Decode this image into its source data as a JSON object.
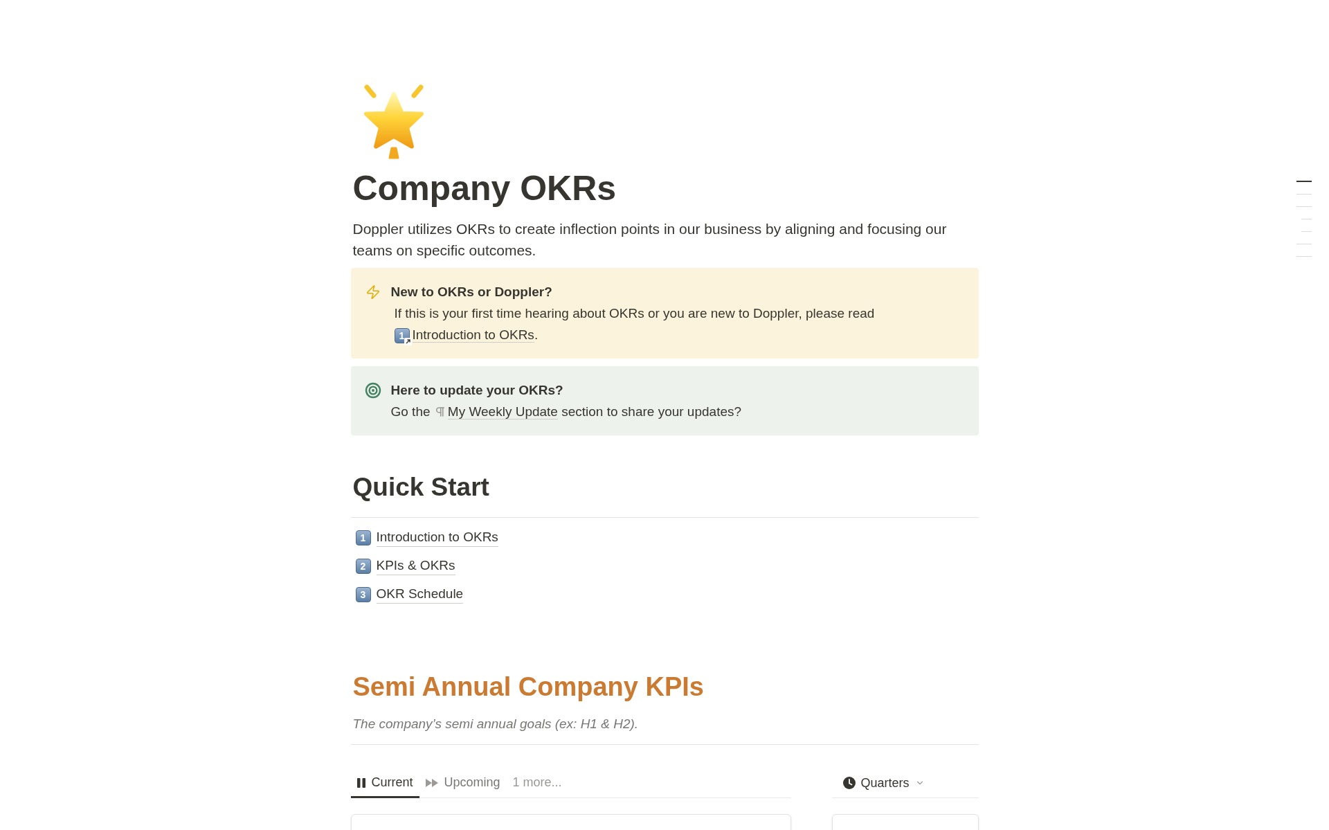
{
  "page": {
    "title": "Company OKRs",
    "description": "Doppler utilizes OKRs to create inflection points in our business by aligning and focusing our teams on specific outcomes."
  },
  "callouts": [
    {
      "kind": "lightning",
      "color": "#fbf3db",
      "title": "New to OKRs or Doppler?",
      "text": "If this is your first time hearing about OKRs or you are new to Doppler, please read",
      "link": {
        "kind": "page",
        "keycap": "1",
        "label": "Introduction to OKRs"
      },
      "after": "."
    },
    {
      "kind": "target",
      "color": "#edf3ec",
      "title": "Here to update your OKRs?",
      "text": "Go the",
      "link": {
        "kind": "block",
        "label": "My Weekly Update"
      },
      "after": "section to share your updates?"
    }
  ],
  "quick_start": {
    "heading": "Quick Start",
    "items": [
      {
        "keycap": "1",
        "label": "Introduction to OKRs"
      },
      {
        "keycap": "2",
        "label": "KPIs & OKRs"
      },
      {
        "keycap": "3",
        "label": "OKR Schedule"
      }
    ]
  },
  "kpis": {
    "heading": "Semi Annual Company KPIs",
    "subtitle": "The company’s semi annual goals (ex: H1 & H2).",
    "views": [
      {
        "kind": "pause",
        "label": "Current",
        "selected": true
      },
      {
        "kind": "forward",
        "label": "Upcoming",
        "selected": false
      }
    ],
    "more": "1 more...",
    "grouping": {
      "label": "Quarters"
    }
  },
  "page_outline": [
    {
      "selected": true
    },
    {
      "selected": false
    },
    {
      "selected": false,
      "children": [
        {
          "selected": false
        },
        {
          "selected": false
        }
      ]
    },
    {
      "selected": false
    },
    {
      "selected": false
    }
  ]
}
